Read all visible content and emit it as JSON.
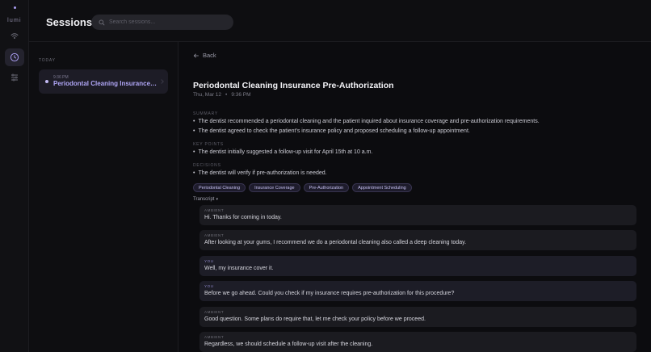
{
  "app": {
    "logo_text": "lumi"
  },
  "header": {
    "title": "Sessions",
    "search_placeholder": "Search sessions..."
  },
  "sidebar": {
    "group_label": "TODAY",
    "session": {
      "time": "9:36 PM",
      "title": "Periodontal Cleaning Insurance Pre-Authorization"
    }
  },
  "detail": {
    "back_label": "Back",
    "title": "Periodontal Cleaning Insurance Pre-Authorization",
    "date": "Thu, Mar 12",
    "separator": "•",
    "time": "9:36 PM",
    "summary_label": "SUMMARY",
    "summary": [
      "The dentist recommended a periodontal cleaning and the patient inquired about insurance coverage and pre-authorization requirements.",
      "The dentist agreed to check the patient's insurance policy and proposed scheduling a follow-up appointment."
    ],
    "key_points_label": "KEY POINTS",
    "key_points": [
      "The dentist initially suggested a follow-up visit for April 15th at 10 a.m."
    ],
    "decisions_label": "DECISIONS",
    "decisions": [
      "The dentist will verify if pre-authorization is needed."
    ],
    "tags": [
      "Periodontal Cleaning",
      "Insurance Coverage",
      "Pre-Authorization",
      "Appointment Scheduling"
    ],
    "transcript_label": "Transcript",
    "transcript": [
      {
        "speaker": "AMBIENT",
        "text": "Hi. Thanks for coming in today."
      },
      {
        "speaker": "AMBIENT",
        "text": "After looking at your gums, I recommend we do a periodontal cleaning also called a deep cleaning today."
      },
      {
        "speaker": "YOU",
        "text": "Well, my insurance cover it."
      },
      {
        "speaker": "YOU",
        "text": "Before we go ahead. Could you check if my insurance requires pre-authorization for this procedure?"
      },
      {
        "speaker": "AMBIENT",
        "text": "Good question. Some plans do require that, let me check your policy before we proceed."
      },
      {
        "speaker": "AMBIENT",
        "text": "Regardless, we should schedule a follow-up visit after the cleaning."
      }
    ]
  },
  "colors": {
    "accent": "#b0a6f6",
    "background": "#0c0c0f",
    "card": "#1b1b20"
  },
  "icons": {
    "rail": [
      "broadcast-icon",
      "clock-icon",
      "sliders-icon"
    ],
    "search": "search-icon",
    "back": "arrow-left-icon"
  }
}
